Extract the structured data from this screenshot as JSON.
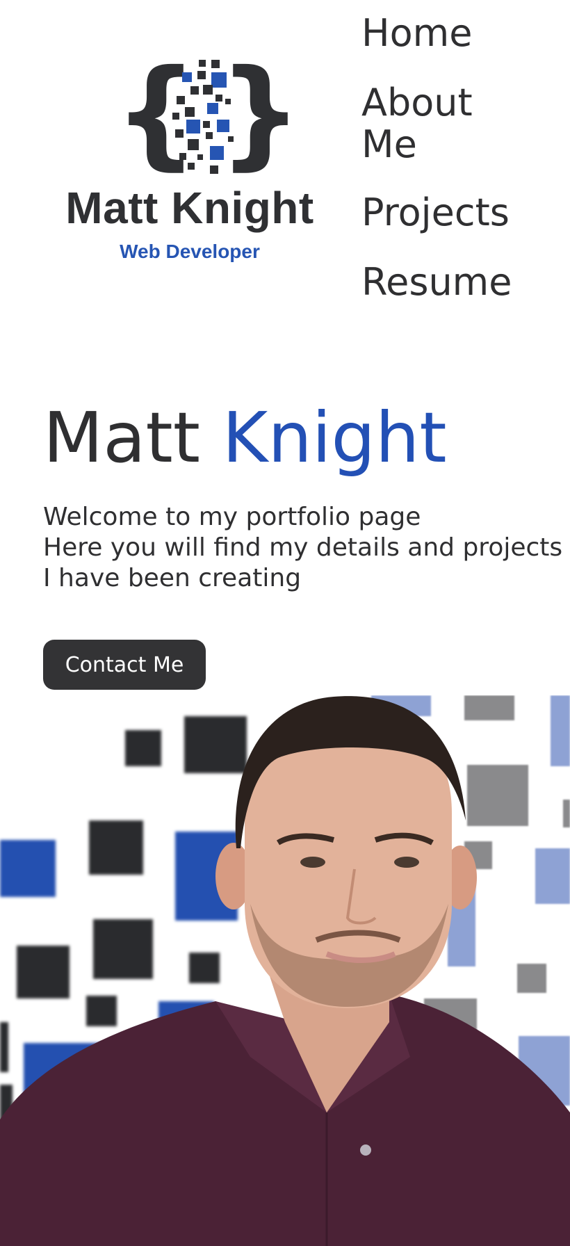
{
  "logo": {
    "name": "Matt Knight",
    "subtitle": "Web Developer",
    "mark_icon": "code-braces-pixels-icon",
    "colors": {
      "dark": "#2f3033",
      "blue": "#2655b3"
    }
  },
  "nav": {
    "items": [
      {
        "label": "Home"
      },
      {
        "label": "About Me"
      },
      {
        "label": "Projects"
      },
      {
        "label": "Resume"
      }
    ]
  },
  "hero": {
    "title_first": "Matt",
    "title_last": "Knight",
    "intro_lines": [
      "Welcome to my portfolio page",
      "Here you will find my details and projects",
      "I have been creating"
    ],
    "contact_label": "Contact Me",
    "colors": {
      "accent": "#2350b5",
      "button_bg": "#333335",
      "text": "#2f2f31"
    }
  },
  "photo": {
    "icon": "profile-photo-icon"
  }
}
